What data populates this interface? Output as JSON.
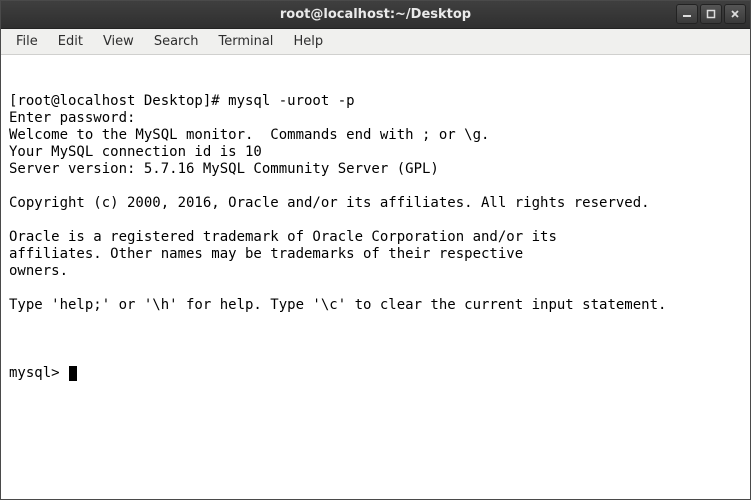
{
  "titlebar": {
    "title": "root@localhost:~/Desktop"
  },
  "window_controls": {
    "minimize_name": "minimize",
    "maximize_name": "maximize",
    "close_name": "close"
  },
  "menubar": {
    "items": [
      {
        "label": "File"
      },
      {
        "label": "Edit"
      },
      {
        "label": "View"
      },
      {
        "label": "Search"
      },
      {
        "label": "Terminal"
      },
      {
        "label": "Help"
      }
    ]
  },
  "terminal": {
    "lines": [
      "[root@localhost Desktop]# mysql -uroot -p",
      "Enter password: ",
      "Welcome to the MySQL monitor.  Commands end with ; or \\g.",
      "Your MySQL connection id is 10",
      "Server version: 5.7.16 MySQL Community Server (GPL)",
      "",
      "Copyright (c) 2000, 2016, Oracle and/or its affiliates. All rights reserved.",
      "",
      "Oracle is a registered trademark of Oracle Corporation and/or its",
      "affiliates. Other names may be trademarks of their respective",
      "owners.",
      "",
      "Type 'help;' or '\\h' for help. Type '\\c' to clear the current input statement.",
      ""
    ],
    "prompt": "mysql> "
  }
}
